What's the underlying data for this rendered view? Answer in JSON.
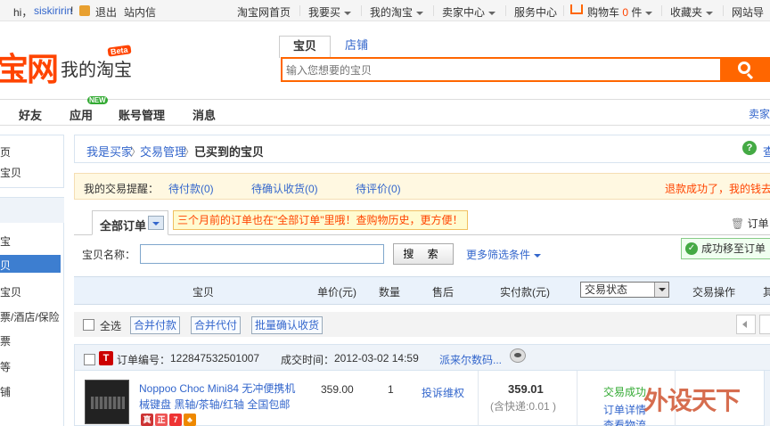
{
  "topbar": {
    "hi": "hi，",
    "username": "siskiririn",
    "exclaim": "!",
    "logout": "退出",
    "inbox": "站内信",
    "taobao_home": "淘宝网首页",
    "buy": "我要买",
    "my_taobao": "我的淘宝",
    "seller_center": "卖家中心",
    "service_center": "服务中心",
    "cart": "购物车",
    "cart_count": "0",
    "cart_unit": "件",
    "favorites": "收藏夹",
    "sitemap": "网站导"
  },
  "header": {
    "logo": "宝网",
    "logo_sub": "我的淘宝",
    "beta": "Beta",
    "search_tab_items": "宝贝",
    "search_tab_shops": "店铺",
    "search_placeholder": "输入您想要的宝贝"
  },
  "nav": {
    "items": [
      "好友",
      "应用",
      "账号管理",
      "消息"
    ],
    "new_badge": "NEW",
    "right": "卖家"
  },
  "sidebar": {
    "top_items": [
      "页",
      "宝贝"
    ],
    "items": [
      "",
      "宝",
      "宝贝",
      "宝贝",
      "票/酒店/保险",
      "票",
      "等",
      "铺"
    ],
    "active_label": "贝"
  },
  "crumb": {
    "buyer": "我是买家",
    "sep": "〉",
    "trade": "交易管理",
    "current": "已买到的宝贝",
    "help": "查"
  },
  "remind": {
    "label": "我的交易提醒：",
    "pending_pay": "待付款(0)",
    "pending_confirm": "待确认收货(0)",
    "pending_review": "待评价(0)",
    "refund": "退款成功了，我的钱去"
  },
  "orders": {
    "tab_all": "全部订单",
    "tip": "三个月前的订单也在\"全部订单\"里哦！查购物历史，更方便！",
    "recycle": "订单",
    "success_msg": "成功移至订单",
    "name_label": "宝贝名称：",
    "search_btn": "搜 索",
    "more_filter": "更多筛选条件",
    "columns": {
      "item": "宝贝",
      "price": "单价(元)",
      "qty": "数量",
      "aftersale": "售后",
      "paid": "实付款(元)",
      "status": "交易状态",
      "action": "交易操作",
      "other": "其"
    },
    "select_all": "全选",
    "batch": [
      "合并付款",
      "合并代付",
      "批量确认收货"
    ],
    "list": [
      {
        "order_no_label": "订单编号：",
        "order_no": "122847532501007",
        "time_label": "成交时间：",
        "time": "2012-03-02 14:59",
        "shop": "派来尔数码...",
        "title": "Noppoo Choc Mini84 无冲便携机械键盘 黑轴/茶轴/红轴 全国包邮",
        "price": "359.00",
        "qty": "1",
        "complaint": "投诉维权",
        "paid": "359.01",
        "shipping": "(含快递:0.01 )",
        "status": "交易成功",
        "detail": "订单详情",
        "logistics": "查看物流"
      }
    ]
  },
  "watermark": "外设天下"
}
